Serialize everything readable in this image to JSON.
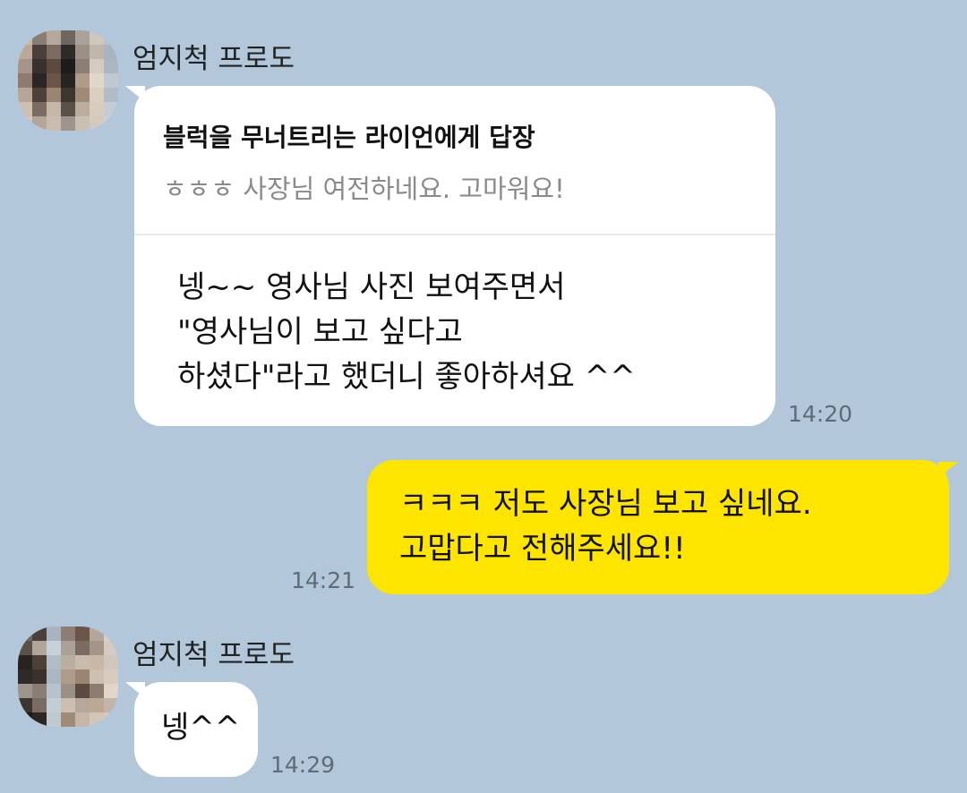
{
  "chat": {
    "messages": [
      {
        "sender": "엄지척 프로도",
        "reply_to": "블럭을 무너트리는 라이언에게 답장",
        "quoted_text": "ㅎㅎㅎ 사장님 여전하네요. 고마워요!",
        "lines": [
          "넹~~ 영사님 사진 보여주면서",
          "\"영사님이 보고 싶다고",
          "하셨다\"라고 했더니 좋아하셔요 ^^"
        ],
        "time": "14:20"
      },
      {
        "sender": "me",
        "lines": [
          "ㅋㅋㅋ 저도 사장님 보고 싶네요.",
          "고맙다고 전해주세요!!"
        ],
        "time": "14:21"
      },
      {
        "sender": "엄지척 프로도",
        "lines": [
          "넹^^"
        ],
        "time": "14:29"
      }
    ]
  },
  "colors": {
    "background": "#b2c7da",
    "incoming_bubble": "#ffffff",
    "outgoing_bubble": "#fee500",
    "time_text": "#5f6b77",
    "quote_text": "#8a8a8a"
  },
  "icons": {
    "avatar": "pixelated-profile-photo"
  }
}
